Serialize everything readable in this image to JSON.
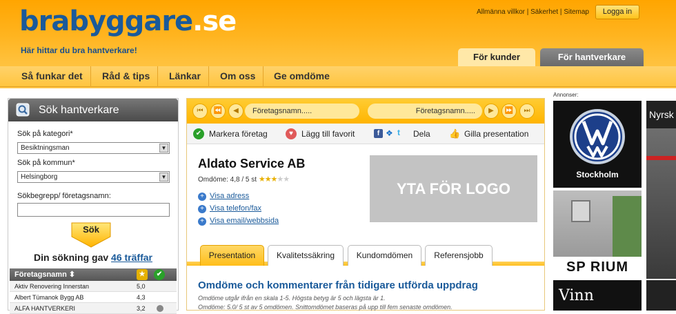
{
  "header": {
    "logo_main": "brabyggare",
    "logo_suffix": ".se",
    "tagline": "Här hittar du bra hantverkare!",
    "toplinks": [
      "Allmänna villkor",
      "Säkerhet",
      "Sitemap"
    ],
    "toplink_sep": " | ",
    "login_label": "Logga in",
    "tab_kunder": "För kunder",
    "tab_hantverkare": "För hantverkare"
  },
  "nav": [
    "Så funkar det",
    "Råd & tips",
    "Länkar",
    "Om oss",
    "Ge omdöme"
  ],
  "sidebar": {
    "title": "Sök hantverkare",
    "category_label": "Sök på kategori*",
    "category_value": "Besiktningsman",
    "kommun_label": "Sök på kommun*",
    "kommun_value": "Helsingborg",
    "search_label": "Sökbegrepp/ företagsnamn:",
    "search_value": "",
    "search_button": "Sök",
    "result_prefix": "Din sökning gav",
    "result_link": "46 träffar",
    "list_header": "Företagsnamn",
    "rows": [
      {
        "name": "Aktiv Renovering Innerstan",
        "score": "5,0"
      },
      {
        "name": "Albert Tümanok Bygg AB",
        "score": "4,3"
      },
      {
        "name": "ALFA HANTVERKERI",
        "score": "3,2"
      }
    ]
  },
  "main": {
    "pager_prev": "Företagsnamn.....",
    "pager_next": "Företagsnamn.....",
    "actions": {
      "mark": "Markera företag",
      "favorite": "Lägg till favorit",
      "share": "Dela",
      "like": "Gilla presentation"
    },
    "company_name": "Aldato Service AB",
    "rating_text": "Omdöme: 4,8 / 5 st",
    "rating_value": 4.8,
    "links": [
      "Visa adress",
      "Visa telefon/fax",
      "Visa email/webbsida"
    ],
    "logo_placeholder": "YTA FÖR LOGO",
    "tabs": [
      "Presentation",
      "Kvalitetssäkring",
      "Kundomdömen",
      "Referensjobb"
    ],
    "active_tab": "Presentation",
    "review_title": "Omdöme och kommentarer från tidigare utförda uppdrag",
    "review_line1": "Omdöme utgår ifrån en skala 1-5. Högsta betyg är 5 och lägsta är 1.",
    "review_line2": "Omdöme: 5.0/ 5 st av 5 omdömen. Snittomdömet baseras på upp till fem senaste omdömen."
  },
  "ads": {
    "label": "Annonser:",
    "vw_caption": "Stockholm",
    "sporium": "SP RIUM",
    "vinn": "Vinn",
    "nyrsk": "Nyrsk"
  },
  "colors": {
    "brand_orange": "#ffb400",
    "brand_blue": "#1a5a9a"
  }
}
